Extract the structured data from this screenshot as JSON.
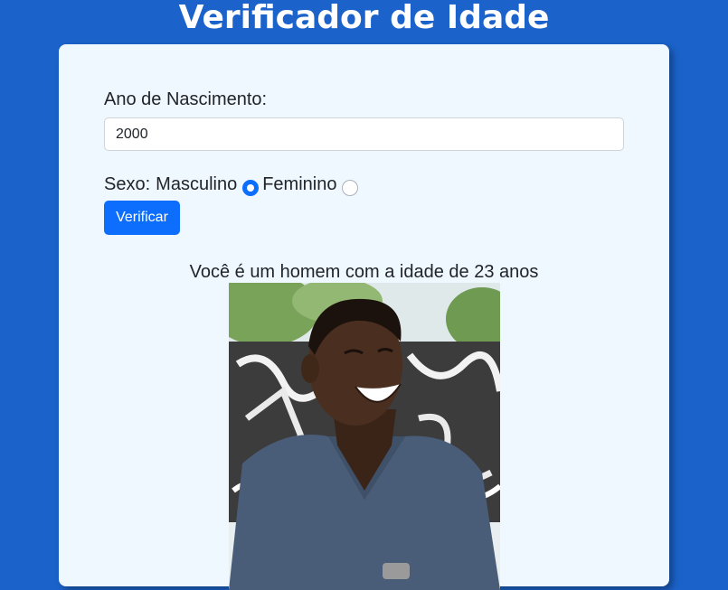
{
  "header": {
    "title": "Verificador de Idade"
  },
  "form": {
    "year_label": "Ano de Nascimento:",
    "year_value": "2000",
    "sex_label": "Sexo:",
    "options": [
      {
        "label": "Masculino",
        "checked": true
      },
      {
        "label": "Feminino",
        "checked": false
      }
    ],
    "submit_label": "Verificar"
  },
  "result": {
    "message": "Você é um homem com a idade de 23 anos",
    "image_alt": "photo-young-man-smiling"
  },
  "colors": {
    "background": "#1b63ca",
    "card": "#f0f8ff",
    "accent": "#0d6efd"
  }
}
